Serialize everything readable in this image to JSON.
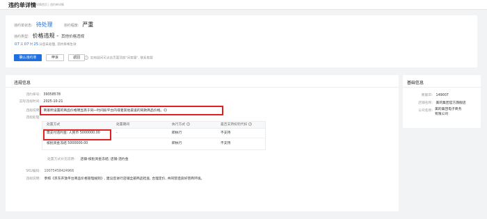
{
  "topbar": {
    "title": "违约单详情",
    "breadcrumb": "详情首页  |  违约单详情"
  },
  "header": {
    "status_label": "违约单状态:",
    "status_value": "待处理",
    "level_label": "违约程度:",
    "level_value": "严重",
    "type_label": "违约类型:",
    "type_value": "价格违规 -",
    "type_sub": "其他价格违规",
    "countdown": {
      "days": "07",
      "days_unit": "天",
      "hours": "07",
      "hours_unit": "时",
      "minutes": "25",
      "suffix": "分后未处理, 违约单将生效"
    },
    "buttons": {
      "confirm": "确认违约单",
      "appeal": "申诉",
      "back": "返回"
    },
    "hint": "如有疑问可点击页面顶部\"问客服\", 联系客服"
  },
  "violation": {
    "section_title": "违规信息",
    "fields": [
      {
        "label": "违约单号:",
        "value": "39358578"
      },
      {
        "label": "实际违规时间:",
        "value": "2025-10-21"
      },
      {
        "label": "违规说明:",
        "value": "商家所设置的商品价格明显高于同一时间段平台内或者其他渠道的同款商品价格。《》"
      },
      {
        "label": "违规处理:",
        "value": ""
      }
    ],
    "table": {
      "headers": [
        "处置方式",
        "处置期间",
        "执行方式",
        "是否支持扣罚代扣"
      ],
      "rows": [
        [
          "需支付违约金: 人民币 5000000.00",
          "-",
          "即执行",
          "不支持"
        ],
        [
          "核批资金冻结 5000000.00",
          "",
          "即执行",
          "不支持"
        ]
      ]
    },
    "note_label": "处置方式补充说明:",
    "note_value": "店铺-核批资金冻结; 店铺-违约金",
    "sku_label": "SKU编码:",
    "sku_value": "10075458424966",
    "advice_label": "违规说明:",
    "advice_value": "参照《京东开放平台商品价格管理规则》, 建议您进行店铺全部商品检查, 合理定价, 共同营造良好营商环境。"
  },
  "basic": {
    "section_title": "基础信息",
    "fields": [
      {
        "label": "商家ID:",
        "value": "149007"
      },
      {
        "label": "店铺名称:",
        "value": "美的集团官方旗舰店"
      },
      {
        "label": "公司名称:",
        "value": "美的集团电子商务有限公司"
      }
    ]
  },
  "colors": {
    "accent": "#1f6fde",
    "highlight": "#e02020"
  }
}
